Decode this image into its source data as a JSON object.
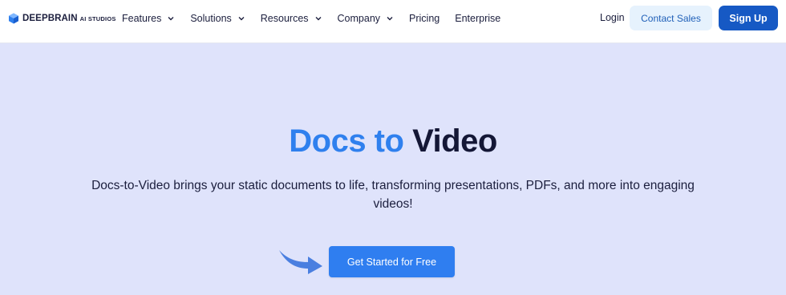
{
  "brand": {
    "name": "DEEPBRAIN",
    "suffix": "AI STUDIOS",
    "logo_icon": "cube-icon"
  },
  "nav": {
    "items": [
      {
        "label": "Features",
        "has_dropdown": true
      },
      {
        "label": "Solutions",
        "has_dropdown": true
      },
      {
        "label": "Resources",
        "has_dropdown": true
      },
      {
        "label": "Company",
        "has_dropdown": true
      },
      {
        "label": "Pricing",
        "has_dropdown": false
      },
      {
        "label": "Enterprise",
        "has_dropdown": false
      }
    ],
    "login_label": "Login",
    "contact_label": "Contact Sales",
    "signup_label": "Sign Up"
  },
  "hero": {
    "title_accent": "Docs to",
    "title_main": "Video",
    "description": "Docs-to-Video brings your static documents to life, transforming presentations, PDFs, and more into engaging videos!",
    "cta_label": "Get Started for Free",
    "cta_icon": "arrow-right-icon"
  },
  "colors": {
    "background": "#dfe3fb",
    "accent": "#2f80ee",
    "primary": "#1659c4",
    "contact_bg": "#e6f2fd",
    "text": "#141736"
  }
}
